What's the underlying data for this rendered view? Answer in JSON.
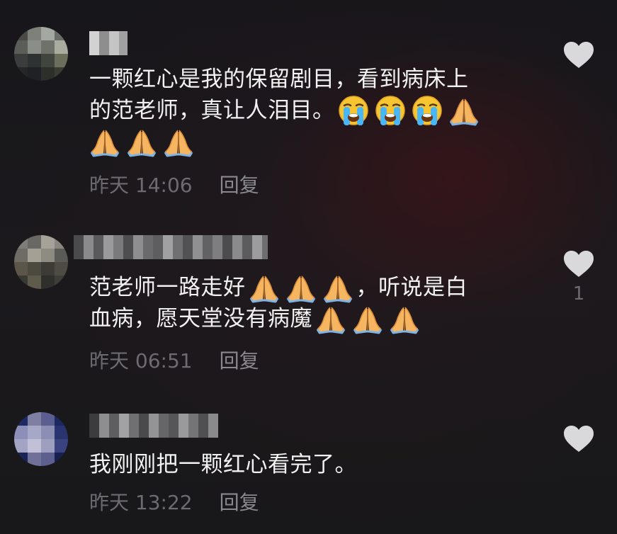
{
  "comments": [
    {
      "text_lines": [
        "一颗红心是我的保留剧目，看到病床上",
        "的范老师，真让人泪目。",
        ""
      ],
      "inline_emojis": [
        [
          "crying-face",
          "crying-face",
          "crying-face",
          "folded-hands"
        ],
        [
          "folded-hands",
          "folded-hands",
          "folded-hands"
        ]
      ],
      "time": "昨天 14:06",
      "reply_label": "回复",
      "likes": ""
    },
    {
      "text_lines": [
        "范老师一路走好",
        "，听说是白",
        "血病，愿天堂没有病魔"
      ],
      "time": "昨天 06:51",
      "reply_label": "回复",
      "likes": "1"
    },
    {
      "text_lines": [
        "我刚刚把一颗红心看完了。"
      ],
      "time": "昨天 13:22",
      "reply_label": "回复",
      "likes": ""
    }
  ],
  "icons": {
    "like": "heart-icon",
    "crying": "crying-face-emoji",
    "pray": "folded-hands-emoji"
  },
  "colors": {
    "text": "#f2f2f2",
    "meta": "#6d6b70",
    "heart": "#d9d9dc"
  }
}
